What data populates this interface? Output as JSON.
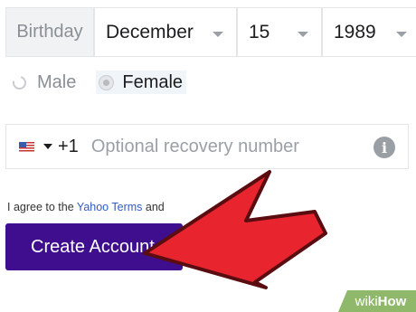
{
  "birthday": {
    "label": "Birthday",
    "month": "December",
    "day": "15",
    "year": "1989"
  },
  "gender": {
    "options": [
      "Male",
      "Female"
    ],
    "selected": "Female"
  },
  "phone": {
    "country_code": "+1",
    "placeholder": "Optional recovery number",
    "info_glyph": "i"
  },
  "terms": {
    "prefix": "I agree to the",
    "link": "Yahoo Terms",
    "suffix": "and"
  },
  "create_button": {
    "label": "Create Account"
  },
  "watermark": {
    "wiki": "wiki",
    "how": "How"
  },
  "colors": {
    "button": "#3e0e8f",
    "arrow": "#e8242f",
    "link": "#2f5cc4"
  }
}
